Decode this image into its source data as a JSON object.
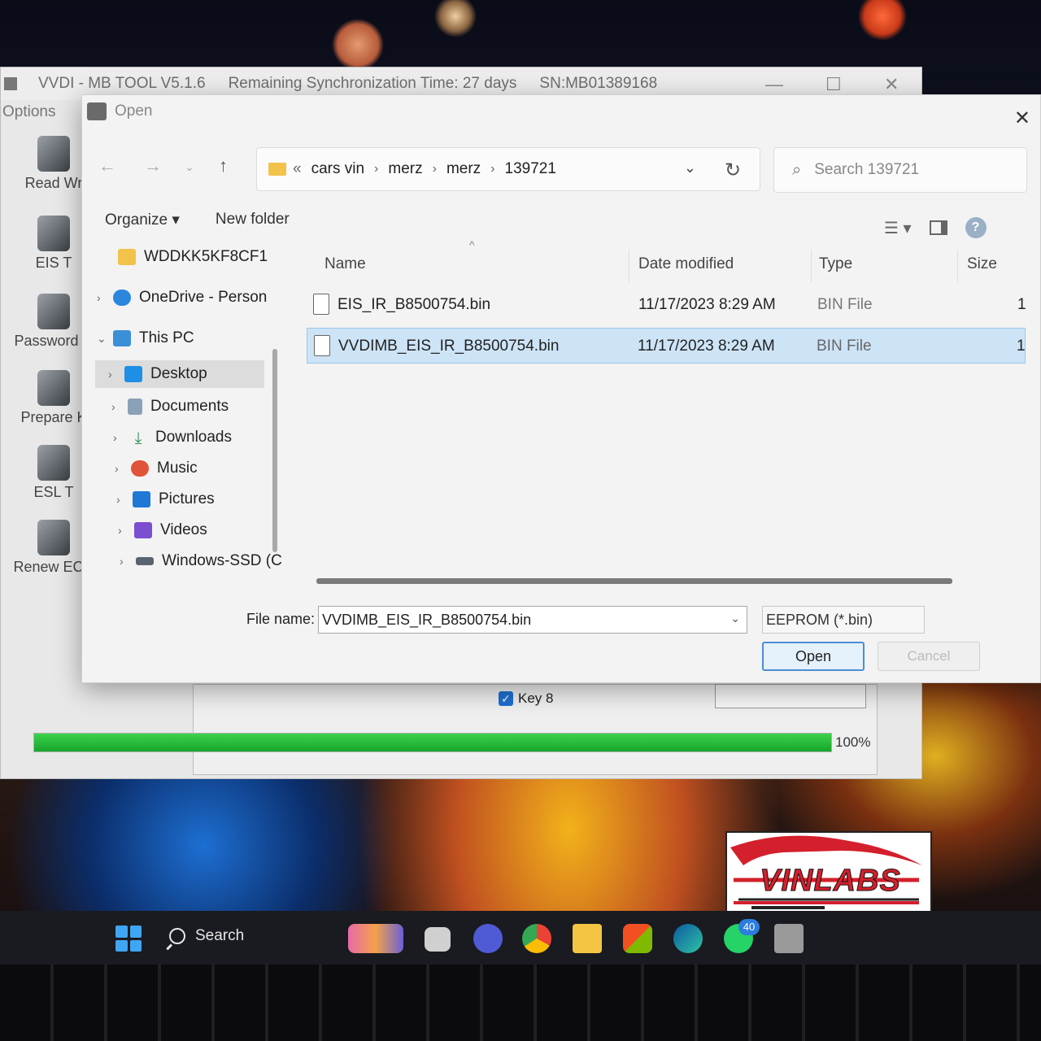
{
  "background_window": {
    "title": "VVDI - MB TOOL V5.1.6",
    "sync_time": "Remaining Synchronization Time: 27 days",
    "serial": "SN:MB01389168",
    "menu": "Options",
    "tools": [
      {
        "label": "Read Wr",
        "icon": "read-write-icon"
      },
      {
        "label": "EIS T",
        "icon": "eis-tool-icon"
      },
      {
        "label": "Password C",
        "icon": "password-calc-icon"
      },
      {
        "label": "Prepare K",
        "icon": "prepare-key-icon"
      },
      {
        "label": "ESL T",
        "icon": "esl-tool-icon"
      },
      {
        "label": "Renew ECU",
        "icon": "renew-ecu-icon"
      }
    ],
    "key8_label": "Key 8",
    "key8_checked": true,
    "progress_percent": 100,
    "progress_text": "100%"
  },
  "dialog": {
    "title": "Open",
    "breadcrumb_prefix": "«",
    "breadcrumb": [
      "cars vin",
      "merz",
      "merz",
      "139721"
    ],
    "search_placeholder": "Search 139721",
    "toolbar": {
      "organize": "Organize ▾",
      "new_folder": "New folder"
    },
    "nav_tree": [
      {
        "label": "WDDKK5KF8CF1",
        "icon": "folder-icon",
        "expandable": false
      },
      {
        "label": "OneDrive - Person",
        "icon": "onedrive-icon",
        "expandable": true
      },
      {
        "label": "This PC",
        "icon": "this-pc-icon",
        "expandable": true,
        "expanded": true
      },
      {
        "label": "Desktop",
        "icon": "desktop-icon",
        "expandable": true,
        "selected": true
      },
      {
        "label": "Documents",
        "icon": "documents-icon",
        "expandable": true
      },
      {
        "label": "Downloads",
        "icon": "downloads-icon",
        "expandable": true
      },
      {
        "label": "Music",
        "icon": "music-icon",
        "expandable": true
      },
      {
        "label": "Pictures",
        "icon": "pictures-icon",
        "expandable": true
      },
      {
        "label": "Videos",
        "icon": "videos-icon",
        "expandable": true
      },
      {
        "label": "Windows-SSD (C",
        "icon": "drive-icon",
        "expandable": true
      }
    ],
    "columns": {
      "name": "Name",
      "date": "Date modified",
      "type": "Type",
      "size": "Size"
    },
    "files": [
      {
        "name": "EIS_IR_B8500754.bin",
        "date": "11/17/2023 8:29 AM",
        "type": "BIN File",
        "size": "1",
        "selected": false
      },
      {
        "name": "VVDIMB_EIS_IR_B8500754.bin",
        "date": "11/17/2023 8:29 AM",
        "type": "BIN File",
        "size": "1",
        "selected": true
      }
    ],
    "file_name_label": "File name:",
    "file_name_value": "VVDIMB_EIS_IR_B8500754.bin",
    "filter": "EEPROM (*.bin)",
    "open_button": "Open",
    "cancel_button": "Cancel"
  },
  "taskbar": {
    "search_label": "Search",
    "whatsapp_badge": "40",
    "apps": [
      "widgets-icon",
      "task-view-icon",
      "teams-icon",
      "chrome-icon",
      "file-explorer-icon",
      "store-icon",
      "edge-icon",
      "whatsapp-icon",
      "vvdi-mb-icon"
    ]
  },
  "logo": {
    "text": "VINLABS"
  },
  "colors": {
    "accent": "#1f6fd0",
    "selection": "#cde4f7",
    "progress": "#1fb53a",
    "logo_red": "#d4202c"
  }
}
